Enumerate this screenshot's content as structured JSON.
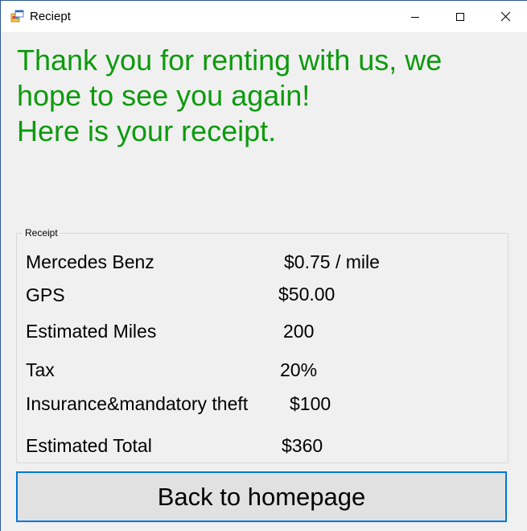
{
  "window": {
    "title": "Reciept",
    "app_icon": "winforms-app-icon",
    "controls": {
      "minimize": "minimize-icon",
      "maximize": "maximize-icon",
      "close": "close-icon"
    }
  },
  "headline": {
    "line1": "Thank you for renting with us, we",
    "line2": "hope to see you again!",
    "line3": "Here is your receipt."
  },
  "receipt": {
    "legend": "Receipt",
    "rows": [
      {
        "label": "Mercedes Benz",
        "value": "$0.75 / mile"
      },
      {
        "label": "GPS",
        "value": "$50.00"
      },
      {
        "label": "Estimated Miles",
        "value": "200"
      },
      {
        "label": "Tax",
        "value": "20%"
      },
      {
        "label": "Insurance&mandatory theft",
        "value": "$100"
      },
      {
        "label": "Estimated Total",
        "value": "$360"
      }
    ]
  },
  "actions": {
    "back_label": "Back to homepage"
  },
  "colors": {
    "headline": "#0d9a0d",
    "focus_border": "#0078d7",
    "button_bg": "#e1e1e1",
    "window_bg": "#f0f0f0"
  }
}
